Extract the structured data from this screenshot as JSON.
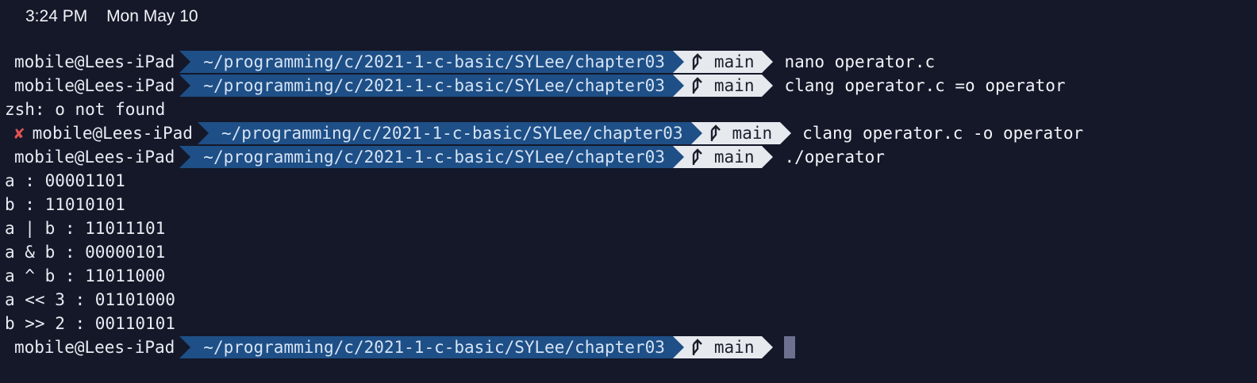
{
  "status_bar": {
    "time": "3:24 PM",
    "date": "Mon May 10"
  },
  "prompt": {
    "context": "mobile@Lees-iPad",
    "path": "~/programming/c/2021-1-c-basic/SYLee/chapter03",
    "branch": "main",
    "error_mark": "✘"
  },
  "commands": [
    "nano operator.c",
    "clang operator.c =o operator",
    "clang operator.c -o operator",
    "./operator"
  ],
  "output": {
    "error_line": "zsh: o not found",
    "lines": [
      "a : 00001101",
      "b : 11010101",
      "a | b : 11011101",
      "a & b : 00000101",
      "a ^ b : 11011000",
      "a << 3 : 01101000",
      "b >> 2 : 00110101"
    ]
  },
  "colors": {
    "background": "#141829",
    "path_segment": "#1e4f87",
    "git_segment": "#e6e9ee",
    "error": "#e05252",
    "cursor": "#6e7090"
  }
}
